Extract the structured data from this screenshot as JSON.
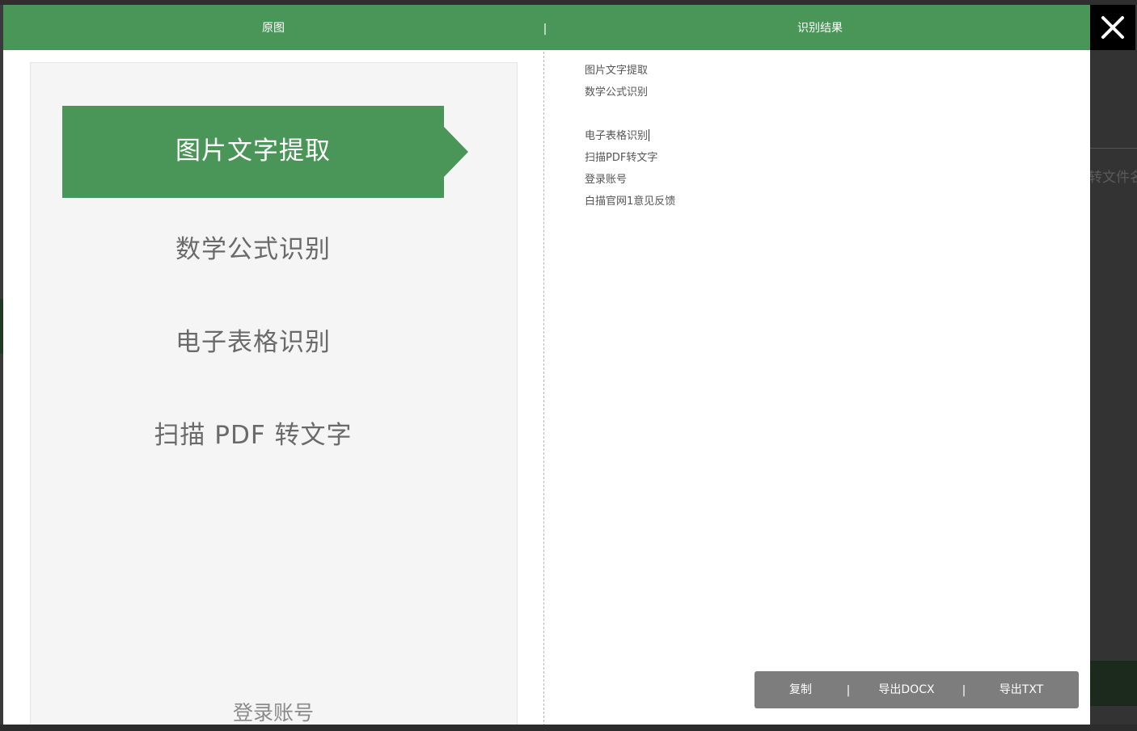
{
  "background": {
    "right_text": "转文件名"
  },
  "header": {
    "left_title": "原图",
    "separator": "|",
    "right_title": "识别结果",
    "close_icon": "close-x-icon"
  },
  "original_image": {
    "active_item": "图片文字提取",
    "items": [
      "数学公式识别",
      "电子表格识别",
      "扫描 PDF 转文字"
    ],
    "login": "登录账号"
  },
  "result": {
    "lines": [
      "图片文字提取",
      "数学公式识别",
      "",
      "电子表格识别",
      "扫描PDF转文字",
      "登录账号",
      "白描官网1意见反馈"
    ]
  },
  "actions": {
    "copy": "复制",
    "separator": "|",
    "export_docx": "导出DOCX",
    "export_txt": "导出TXT"
  },
  "colors": {
    "accent": "#4a9658",
    "action_bar": "#7d7d7d",
    "close_bg": "#000000"
  }
}
